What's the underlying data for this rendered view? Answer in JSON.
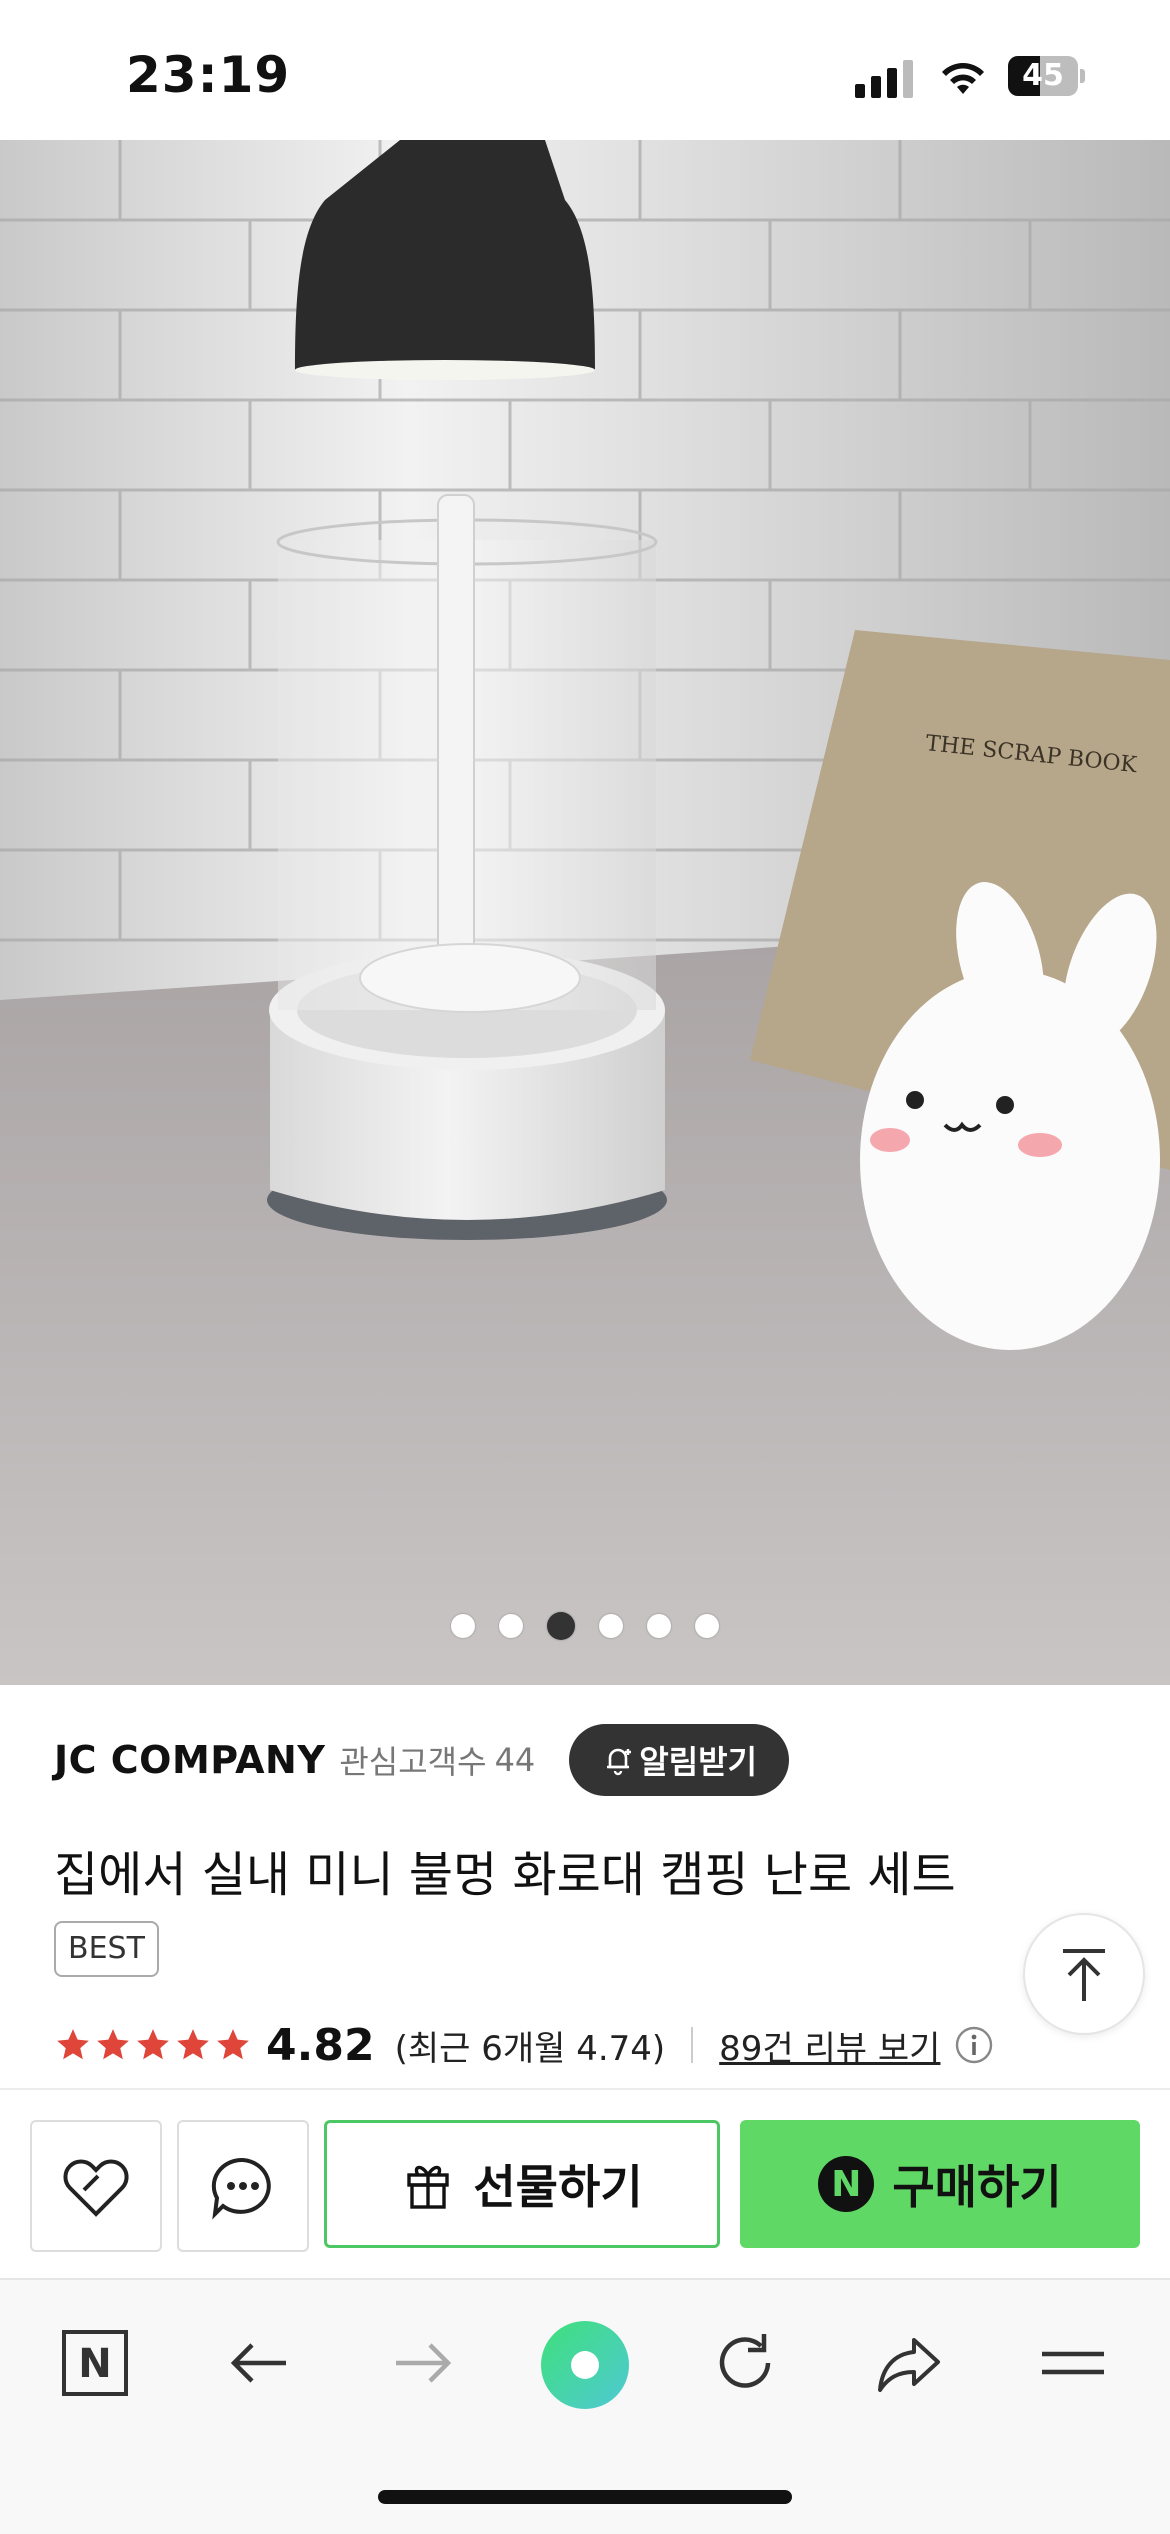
{
  "status_bar": {
    "time": "23:19",
    "battery": "45",
    "battery_level": 0.45
  },
  "carousel": {
    "total": 6,
    "active_index": 2
  },
  "image_text": {
    "book_title": "THE SCRAP BOOK"
  },
  "seller": {
    "name": "JC COMPANY",
    "fans_label": "관심고객수",
    "fans_count": "44",
    "alarm_label": "알림받기"
  },
  "product": {
    "title": "집에서 실내 미니 불멍 화로대 캠핑 난로 세트",
    "badge": "BEST"
  },
  "rating": {
    "stars": 5,
    "score": "4.82",
    "recent": "(최근 6개월 4.74)",
    "reviews_link": "89건 리뷰 보기"
  },
  "actions": {
    "gift_label": "선물하기",
    "buy_label": "구매하기",
    "buy_badge": "N"
  },
  "browser": {
    "home_label": "N"
  },
  "colors": {
    "accent_green": "#5fd866",
    "gift_border": "#4cc764",
    "star": "#e0453a",
    "dark_button": "#333333"
  },
  "icons": [
    "heart-icon",
    "chat-icon",
    "gift-icon",
    "naver-n-icon",
    "back-arrow-icon",
    "forward-arrow-icon",
    "green-dot-icon",
    "reload-icon",
    "share-icon",
    "menu-icon",
    "scroll-top-icon",
    "info-icon",
    "bell-icon"
  ]
}
